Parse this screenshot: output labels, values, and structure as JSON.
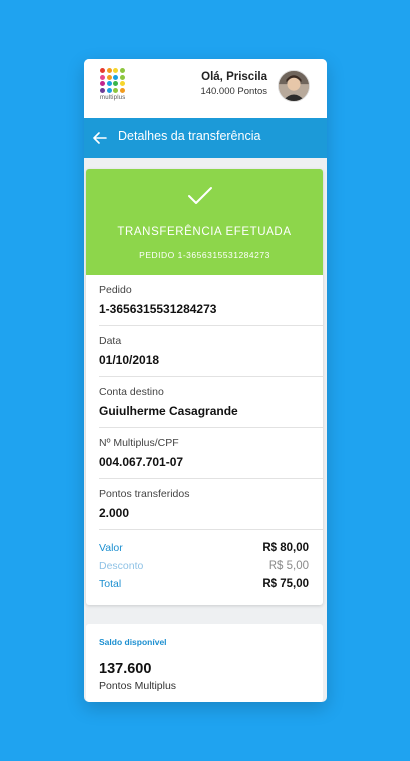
{
  "topbar": {
    "logo_text": "multiplus",
    "logo_colors": [
      "#e63b2e",
      "#f29b1e",
      "#f6d52b",
      "#8dc63f",
      "#e6468d",
      "#f29b1e",
      "#1ca0e0",
      "#8dc63f",
      "#c2248e",
      "#1ca0e0",
      "#39b54a",
      "#f6d52b",
      "#6d3d98",
      "#1ca0e0",
      "#8dc63f",
      "#f29b1e"
    ],
    "greeting": "Olá, Priscila",
    "points": "140.000 Pontos"
  },
  "header": {
    "title": "Detalhes da transferência"
  },
  "status": {
    "title": "TRANSFERÊNCIA EFETUADA",
    "order_ref": "PEDIDO 1-3656315531284273",
    "color": "#8dd64b"
  },
  "details": [
    {
      "label": "Pedido",
      "value": "1-3656315531284273"
    },
    {
      "label": "Data",
      "value": "01/10/2018"
    },
    {
      "label": "Conta destino",
      "value": "Guiulherme Casagrande"
    },
    {
      "label": "Nº Multiplus/CPF",
      "value": "004.067.701-07"
    },
    {
      "label": "Pontos transferidos",
      "value": "2.000"
    }
  ],
  "totals": {
    "valor_label": "Valor",
    "valor": "R$ 80,00",
    "desconto_label": "Desconto",
    "desconto": "R$ 5,00",
    "total_label": "Total",
    "total": "R$ 75,00"
  },
  "balance": {
    "label": "Saldo disponível",
    "value": "137.600",
    "unit": "Pontos Multiplus"
  },
  "colors": {
    "background": "#1fa3f0",
    "header": "#1c9ad8",
    "success": "#8dd64b",
    "link": "#1c8fd0"
  }
}
